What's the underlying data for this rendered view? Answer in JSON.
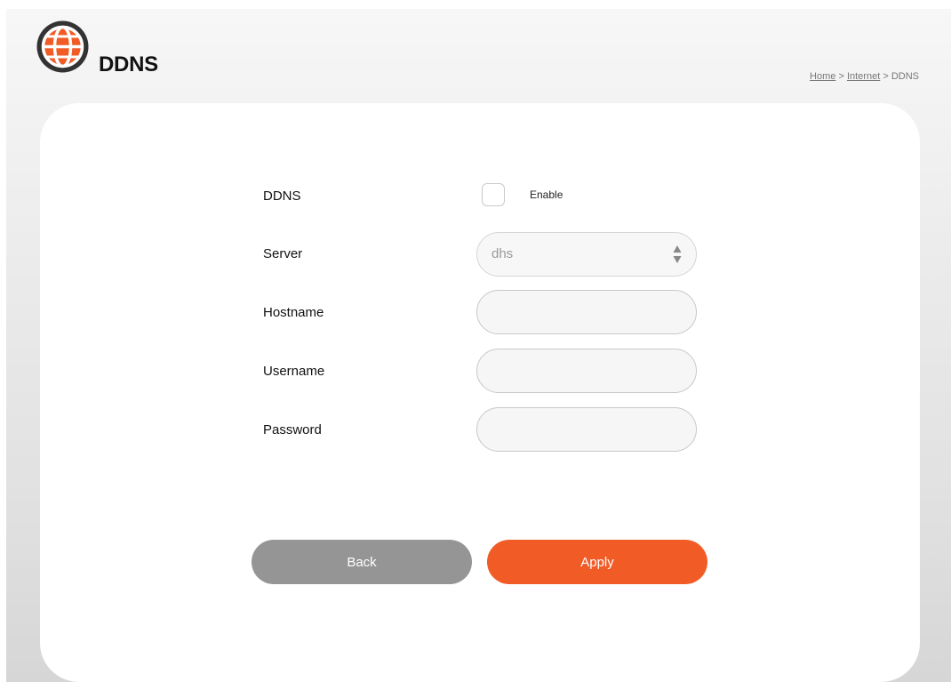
{
  "header": {
    "title": "DDNS",
    "icon": "globe-icon",
    "accent": "#f15b26"
  },
  "breadcrumb": {
    "home": "Home",
    "sep1": ">",
    "internet": "Internet",
    "sep2": ">",
    "current": "DDNS"
  },
  "form": {
    "ddns_label": "DDNS",
    "enable_label": "Enable",
    "enable_checked": false,
    "server_label": "Server",
    "server_value": "dhs",
    "hostname_label": "Hostname",
    "hostname_value": "",
    "username_label": "Username",
    "username_value": "",
    "password_label": "Password",
    "password_value": ""
  },
  "buttons": {
    "back": "Back",
    "apply": "Apply"
  }
}
